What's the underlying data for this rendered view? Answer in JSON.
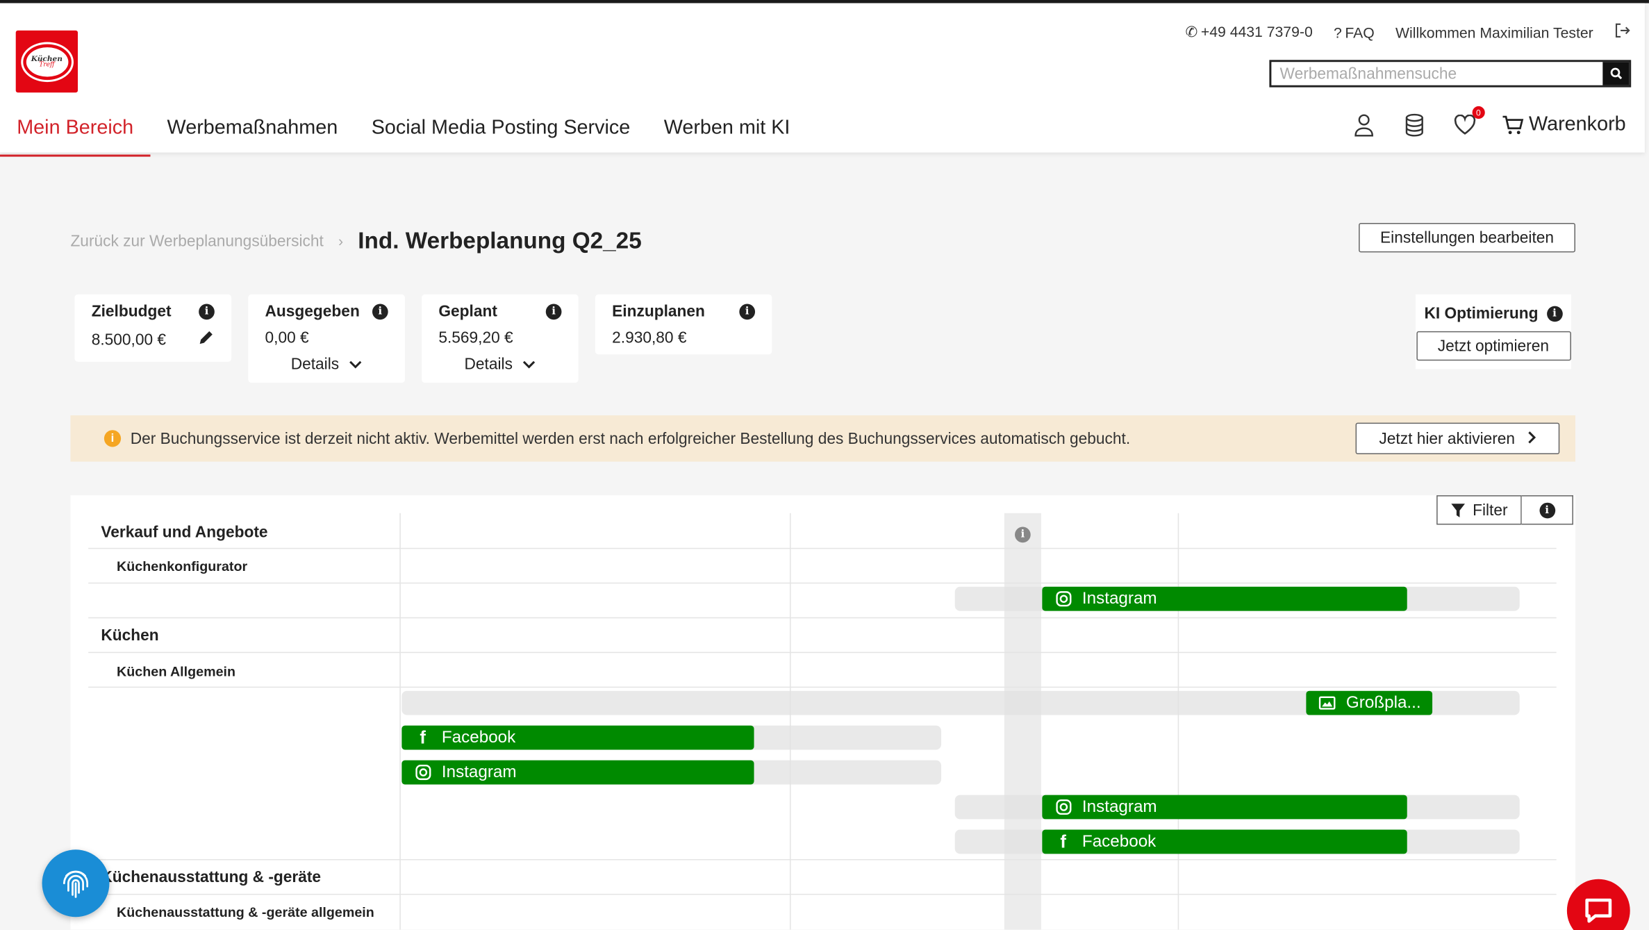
{
  "brand": {
    "logo_line1": "Küchen",
    "logo_line2": "Treff"
  },
  "header": {
    "phone": "+49 4431 7379-0",
    "faq": "FAQ",
    "welcome": "Willkommen Maximilian Tester",
    "search_placeholder": "Werbemaßnahmensuche",
    "nav": [
      "Mein Bereich",
      "Werbemaßnahmen",
      "Social Media Posting Service",
      "Werben mit KI"
    ],
    "wishlist_count": "0",
    "cart_label": "Warenkorb"
  },
  "breadcrumb": {
    "back": "Zurück zur Werbeplanungsübersicht",
    "title": "Ind. Werbeplanung Q2_25"
  },
  "settings_button": "Einstellungen bearbeiten",
  "kpis": [
    {
      "label": "Zielbudget",
      "value": "8.500,00 €"
    },
    {
      "label": "Ausgegeben",
      "value": "0,00 €",
      "details": "Details"
    },
    {
      "label": "Geplant",
      "value": "5.569,20 €",
      "details": "Details"
    },
    {
      "label": "Einzuplanen",
      "value": "2.930,80 €"
    }
  ],
  "ki": {
    "label": "KI Optimierung",
    "button": "Jetzt optimieren"
  },
  "banner": {
    "text": "Der Buchungsservice ist derzeit nicht aktiv. Werbemittel werden erst nach erfolgreicher Bestellung des Buchungsservices automatisch gebucht.",
    "action": "Jetzt hier aktivieren"
  },
  "timeline": {
    "filter": "Filter",
    "groups": [
      {
        "name": "Verkauf und Angebote"
      },
      {
        "name": "Küchenkonfigurator"
      },
      {
        "name": "Küchen"
      },
      {
        "name": "Küchen Allgemein"
      },
      {
        "name": "Küchenausstattung & -geräte"
      },
      {
        "name": "Küchenausstattung & -geräte allgemein"
      }
    ],
    "bars": [
      "Instagram",
      "Großpla...",
      "Facebook",
      "Instagram",
      "Instagram",
      "Facebook"
    ]
  },
  "colors": {
    "brand_red": "#e30613",
    "bar_green": "#008a00",
    "banner_bg": "#f7ead5",
    "fab_blue": "#1a8dd6"
  }
}
